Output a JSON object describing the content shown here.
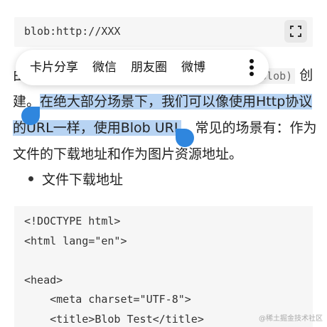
{
  "top_code": {
    "text": "blob:http://XXX"
  },
  "share_menu": {
    "items": [
      "卡片分享",
      "微信",
      "朋友圈",
      "微博"
    ]
  },
  "paragraph": {
    "line1_start": "由",
    "line1_code": "blob)",
    "line1_end": "创",
    "line2_plain": "建。",
    "line2_highlight": "在绝大部分场景下，我们可以像使用Http协议",
    "line3_highlight": "的URL一样，使用Blob URL",
    "line3_plain": "。常见的场景有：作为",
    "line4": "文件的下载地址和作为图片资源地址。"
  },
  "bullet": {
    "text": "文件下载地址"
  },
  "code_block": {
    "lines": [
      "<!DOCTYPE html>",
      "<html lang=\"en\">",
      "",
      "<head>",
      "    <meta charset=\"UTF-8\">",
      "    <title>Blob Test</title>"
    ]
  },
  "watermark": "@稀土掘金技术社区"
}
